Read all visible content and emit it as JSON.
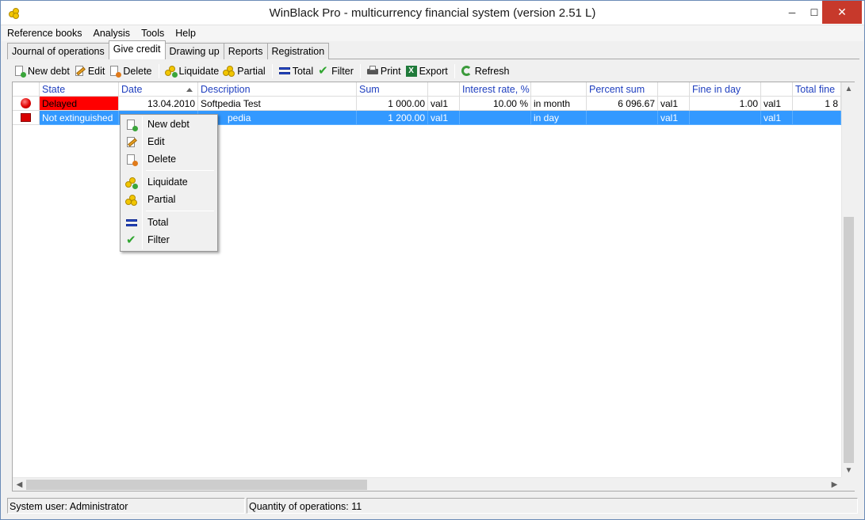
{
  "window": {
    "title": "WinBlack Pro - multicurrency financial system (version 2.51 L)",
    "minimize": "─",
    "maximize": "☐",
    "close": "✕"
  },
  "menu": [
    "Reference books",
    "Analysis",
    "Tools",
    "Help"
  ],
  "tabs": [
    "Journal of operations",
    "Give credit",
    "Drawing up",
    "Reports",
    "Registration"
  ],
  "active_tab": "Give credit",
  "toolbar": {
    "new_debt": "New debt",
    "edit": "Edit",
    "delete": "Delete",
    "liquidate": "Liquidate",
    "partial": "Partial",
    "total": "Total",
    "filter": "Filter",
    "print": "Print",
    "export": "Export",
    "refresh": "Refresh"
  },
  "grid": {
    "columns": [
      "State",
      "Date",
      "Description",
      "Sum",
      "",
      "Interest rate, %",
      "",
      "Percent sum",
      "",
      "Fine in day",
      "",
      "Total fine"
    ],
    "rows": [
      {
        "state": "Delayed",
        "date": "13.04.2010",
        "description": "Softpedia Test",
        "sum": "1 000.00",
        "sum_cur": "val1",
        "rate": "10.00 %",
        "period": "in month",
        "percent_sum": "6 096.67",
        "percent_cur": "val1",
        "fine_day": "1.00",
        "fine_cur": "val1",
        "total_fine": "1 8"
      },
      {
        "state": "Not extinguished",
        "date": "",
        "description": "pedia",
        "sum": "1 200.00",
        "sum_cur": "val1",
        "rate": "",
        "period": "in day",
        "percent_sum": "",
        "percent_cur": "val1",
        "fine_day": "",
        "fine_cur": "val1",
        "total_fine": ""
      }
    ]
  },
  "context_menu": {
    "new_debt": "New debt",
    "edit": "Edit",
    "delete": "Delete",
    "liquidate": "Liquidate",
    "partial": "Partial",
    "total": "Total",
    "filter": "Filter"
  },
  "status": {
    "user": "System user: Administrator",
    "quantity": "Quantity of operations: 11"
  },
  "scroll": {
    "up": "▲",
    "down": "▼",
    "left": "◀",
    "right": "▶"
  },
  "colors": {
    "delayed": "#ff0000",
    "selection": "#3399ff",
    "header_text": "#1f3fbf"
  }
}
